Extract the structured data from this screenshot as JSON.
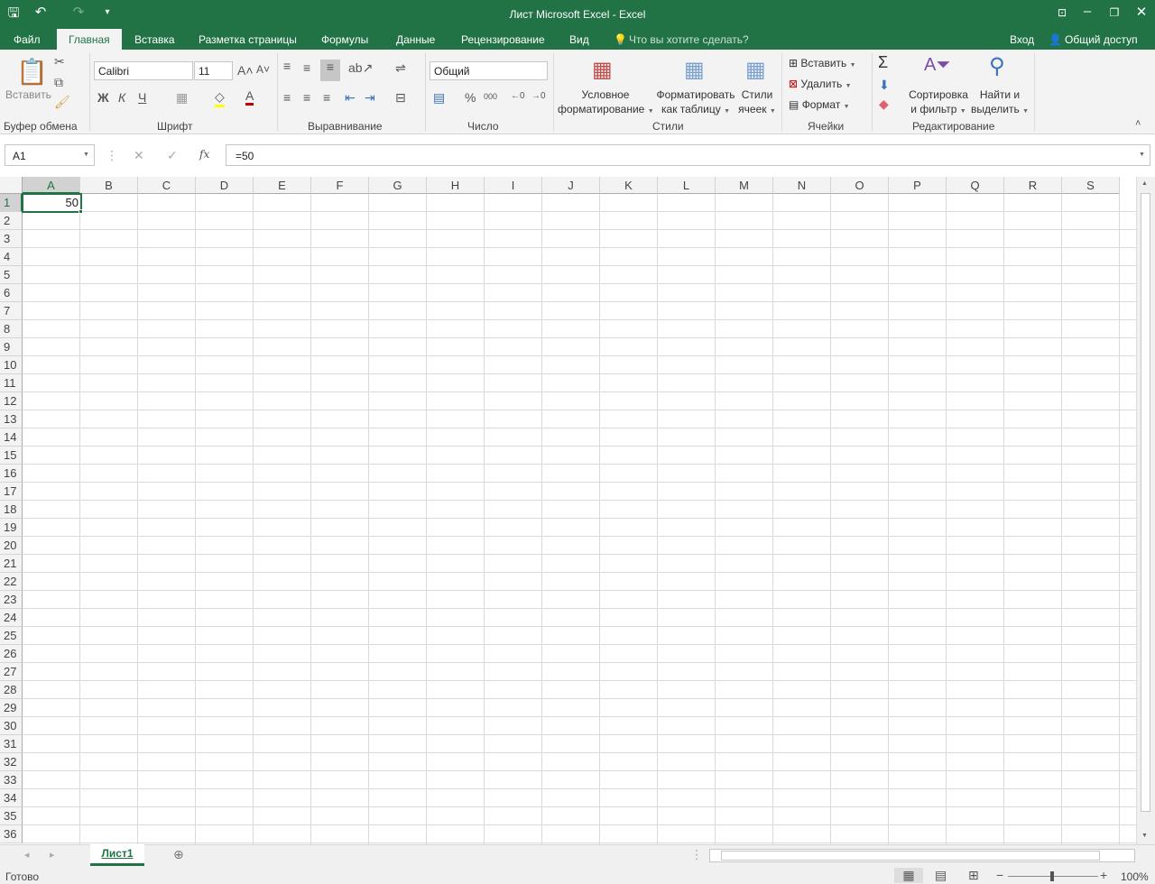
{
  "title": "Лист Microsoft Excel - Excel",
  "tabs": [
    "Файл",
    "Главная",
    "Вставка",
    "Разметка страницы",
    "Формулы",
    "Данные",
    "Рецензирование",
    "Вид"
  ],
  "tell_me": "Что вы хотите сделать?",
  "signin": "Вход",
  "share": "Общий доступ",
  "ribbon": {
    "clipboard": {
      "paste": "Вставить",
      "group": "Буфер обмена"
    },
    "font": {
      "name": "Calibri",
      "size": "11",
      "bold": "Ж",
      "italic": "К",
      "underline": "Ч",
      "group": "Шрифт"
    },
    "alignment": {
      "group": "Выравнивание"
    },
    "number": {
      "format": "Общий",
      "percent": "%",
      "thousands": "000",
      "group": "Число"
    },
    "styles": {
      "cond1": "Условное",
      "cond2": "форматирование",
      "table1": "Форматировать",
      "table2": "как таблицу",
      "cell1": "Стили",
      "cell2": "ячеек",
      "group": "Стили"
    },
    "cells": {
      "insert": "Вставить",
      "delete": "Удалить",
      "format": "Формат",
      "group": "Ячейки"
    },
    "editing": {
      "sort1": "Сортировка",
      "sort2": "и фильтр",
      "find1": "Найти и",
      "find2": "выделить",
      "group": "Редактирование"
    }
  },
  "namebox": "A1",
  "formula": "=50",
  "columns": [
    "A",
    "B",
    "C",
    "D",
    "E",
    "F",
    "G",
    "H",
    "I",
    "J",
    "K",
    "L",
    "M",
    "N",
    "O",
    "P",
    "Q",
    "R",
    "S"
  ],
  "row_count": 36,
  "cell_a1": "50",
  "sheet_tab": "Лист1",
  "status": "Готово",
  "zoom": "100%"
}
